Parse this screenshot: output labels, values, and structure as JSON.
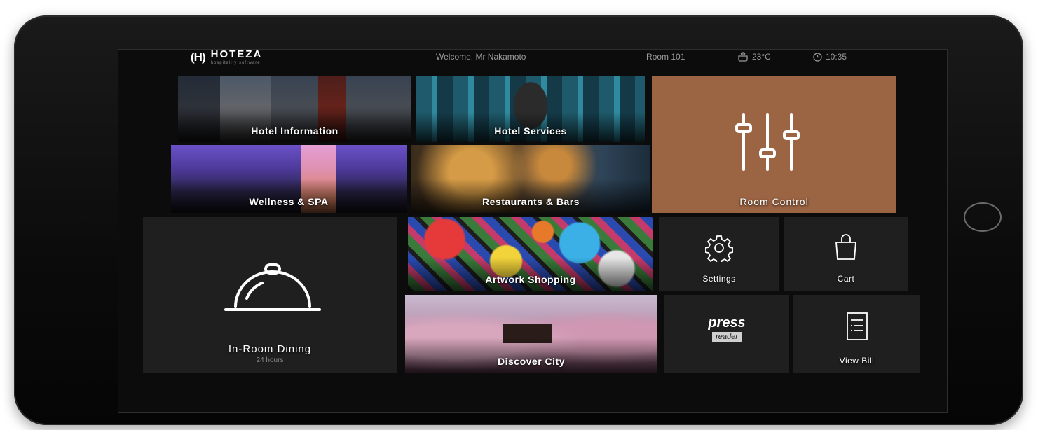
{
  "header": {
    "brand": "HOTEZA",
    "tagline": "hospitality software",
    "welcome": "Welcome, Mr Nakamoto",
    "room": "Room 101",
    "temperature": "23°C",
    "time": "10:35"
  },
  "tiles": {
    "hotel_information": "Hotel Information",
    "hotel_services": "Hotel Services",
    "wellness": "Wellness & SPA",
    "restaurants": "Restaurants & Bars",
    "room_control": "Room Control",
    "dining": "In-Room Dining",
    "dining_sub": "24 hours",
    "artwork": "Artwork Shopping",
    "discover": "Discover City",
    "settings": "Settings",
    "cart": "Cart",
    "press_word": "press",
    "reader_word": "reader",
    "bill": "View Bill"
  },
  "colors": {
    "accent": "#9b6443",
    "tile": "#1f1f1f",
    "screen": "#0c0c0c"
  },
  "icons": {
    "temperature": "thermostat-icon",
    "time": "clock-icon",
    "room_control": "sliders-icon",
    "dining": "cloche-icon",
    "settings": "gear-icon",
    "cart": "shopping-bag-icon",
    "bill": "receipt-icon"
  }
}
